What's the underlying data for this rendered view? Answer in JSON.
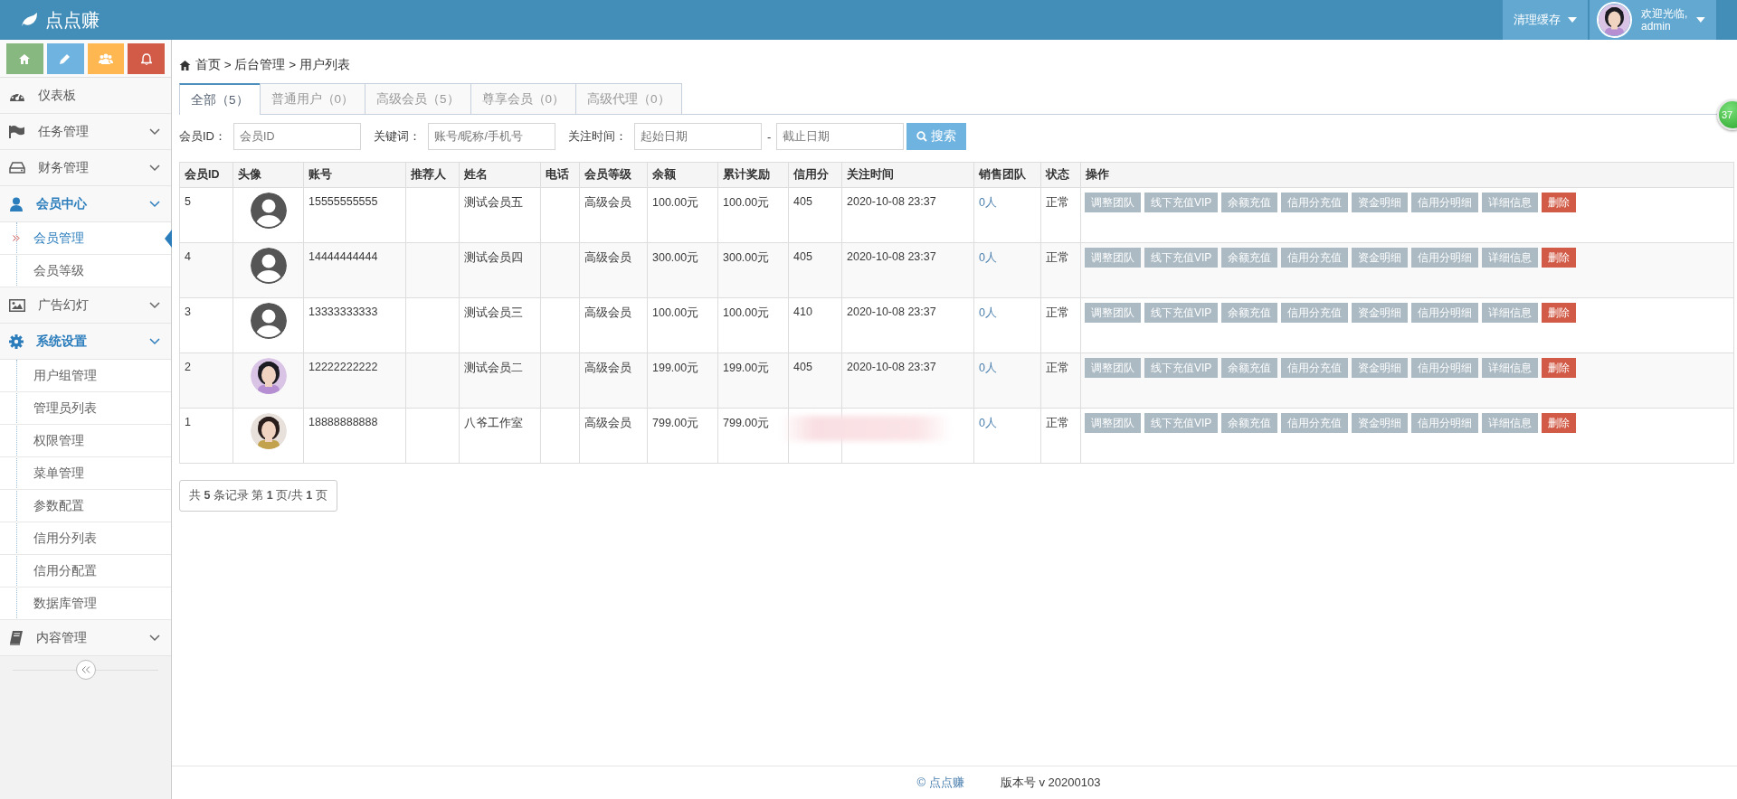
{
  "header": {
    "logo": "点点赚",
    "cache_button": "清理缓存",
    "welcome": "欢迎光临,",
    "user": "admin"
  },
  "badge": "37",
  "sidebar": {
    "shortcuts": [
      {
        "color": "#87b87f"
      },
      {
        "color": "#6fb3e0"
      },
      {
        "color": "#ffb752"
      },
      {
        "color": "#d15b47"
      }
    ],
    "items": [
      {
        "label": "仪表板",
        "kind": "link"
      },
      {
        "label": "任务管理",
        "kind": "menu",
        "expanded": false
      },
      {
        "label": "财务管理",
        "kind": "menu",
        "expanded": false
      },
      {
        "label": "会员中心",
        "kind": "menu",
        "expanded": true,
        "children": [
          {
            "label": "会员管理",
            "selected": true
          },
          {
            "label": "会员等级",
            "selected": false
          }
        ]
      },
      {
        "label": "广告幻灯",
        "kind": "menu",
        "expanded": false
      },
      {
        "label": "系统设置",
        "kind": "menu",
        "expanded": true,
        "children": [
          {
            "label": "用户组管理",
            "selected": false
          },
          {
            "label": "管理员列表",
            "selected": false
          },
          {
            "label": "权限管理",
            "selected": false
          },
          {
            "label": "菜单管理",
            "selected": false
          },
          {
            "label": "参数配置",
            "selected": false
          },
          {
            "label": "信用分列表",
            "selected": false
          },
          {
            "label": "信用分配置",
            "selected": false
          },
          {
            "label": "数据库管理",
            "selected": false
          }
        ]
      },
      {
        "label": "内容管理",
        "kind": "menu",
        "expanded": false
      }
    ]
  },
  "breadcrumb": "首页 > 后台管理 > 用户列表",
  "tabs": [
    {
      "label": "全部（5）",
      "selected": true
    },
    {
      "label": "普通用户（0）",
      "selected": false
    },
    {
      "label": "高级会员（5）",
      "selected": false
    },
    {
      "label": "尊享会员（0）",
      "selected": false
    },
    {
      "label": "高级代理（0）",
      "selected": false
    }
  ],
  "filters": {
    "member_id": {
      "label": "会员ID：",
      "placeholder": "会员ID"
    },
    "keyword": {
      "label": "关键词：",
      "placeholder": "账号/昵称/手机号"
    },
    "date": {
      "label": "关注时间：",
      "start_placeholder": "起始日期",
      "separator": "-",
      "end_placeholder": "截止日期"
    },
    "search_button": "搜索"
  },
  "table": {
    "columns": [
      "会员ID",
      "头像",
      "账号",
      "推荐人",
      "姓名",
      "电话",
      "会员等级",
      "余额",
      "累计奖励",
      "信用分",
      "关注时间",
      "销售团队",
      "状态",
      "操作"
    ],
    "rows": [
      {
        "id": "5",
        "avatar": {
          "kind": "default"
        },
        "account": "15555555555",
        "name": "测试会员五",
        "level": "高级会员",
        "balance": "100.00元",
        "reward": "100.00元",
        "credit": "405",
        "time": "2020-10-08 23:37",
        "team": "0人",
        "status": "正常",
        "actions": [
          {
            "label": "调整团队",
            "kind": "default"
          },
          {
            "label": "线下充值VIP",
            "kind": "default"
          },
          {
            "label": "余额充值",
            "kind": "default"
          },
          {
            "label": "信用分充值",
            "kind": "default"
          },
          {
            "label": "资金明细",
            "kind": "default"
          },
          {
            "label": "信用分明细",
            "kind": "default"
          },
          {
            "label": "详细信息",
            "kind": "default"
          },
          {
            "label": "删除",
            "kind": "danger"
          }
        ]
      },
      {
        "id": "4",
        "avatar": {
          "kind": "default"
        },
        "account": "14444444444",
        "name": "测试会员四",
        "level": "高级会员",
        "balance": "300.00元",
        "reward": "300.00元",
        "credit": "405",
        "time": "2020-10-08 23:37",
        "team": "0人",
        "status": "正常",
        "actions": [
          {
            "label": "调整团队",
            "kind": "default"
          },
          {
            "label": "线下充值VIP",
            "kind": "default"
          },
          {
            "label": "余额充值",
            "kind": "default"
          },
          {
            "label": "信用分充值",
            "kind": "default"
          },
          {
            "label": "资金明细",
            "kind": "default"
          },
          {
            "label": "信用分明细",
            "kind": "default"
          },
          {
            "label": "详细信息",
            "kind": "default"
          },
          {
            "label": "删除",
            "kind": "danger"
          }
        ]
      },
      {
        "id": "3",
        "avatar": {
          "kind": "default"
        },
        "account": "13333333333",
        "name": "测试会员三",
        "level": "高级会员",
        "balance": "100.00元",
        "reward": "100.00元",
        "credit": "410",
        "time": "2020-10-08 23:37",
        "team": "0人",
        "status": "正常",
        "actions": [
          {
            "label": "调整团队",
            "kind": "default"
          },
          {
            "label": "线下充值VIP",
            "kind": "default"
          },
          {
            "label": "余额充值",
            "kind": "default"
          },
          {
            "label": "信用分充值",
            "kind": "default"
          },
          {
            "label": "资金明细",
            "kind": "default"
          },
          {
            "label": "信用分明细",
            "kind": "default"
          },
          {
            "label": "详细信息",
            "kind": "default"
          },
          {
            "label": "删除",
            "kind": "danger"
          }
        ]
      },
      {
        "id": "2",
        "account": "12222222222",
        "name": "测试会员二",
        "level": "高级会员",
        "balance": "199.00元",
        "reward": "199.00元",
        "credit": "405",
        "time": "2020-10-08 23:37",
        "team": "0人",
        "status": "正常",
        "actions": [
          {
            "label": "调整团队",
            "kind": "default"
          },
          {
            "label": "线下充值VIP",
            "kind": "default"
          },
          {
            "label": "余额充值",
            "kind": "default"
          },
          {
            "label": "信用分充值",
            "kind": "default"
          },
          {
            "label": "资金明细",
            "kind": "default"
          },
          {
            "label": "信用分明细",
            "kind": "default"
          },
          {
            "label": "详细信息",
            "kind": "default"
          },
          {
            "label": "删除",
            "kind": "danger"
          }
        ]
      },
      {
        "id": "1",
        "account": "18888888888",
        "name": "八爷工作室",
        "level": "高级会员",
        "balance": "799.00元",
        "reward": "799.00元",
        "redacted": true,
        "team": "0人",
        "status": "正常",
        "actions": [
          {
            "label": "调整团队",
            "kind": "default"
          },
          {
            "label": "线下充值VIP",
            "kind": "default"
          },
          {
            "label": "余额充值",
            "kind": "default"
          },
          {
            "label": "信用分充值",
            "kind": "default"
          },
          {
            "label": "资金明细",
            "kind": "default"
          },
          {
            "label": "信用分明细",
            "kind": "default"
          },
          {
            "label": "详细信息",
            "kind": "default"
          },
          {
            "label": "删除",
            "kind": "danger"
          }
        ]
      }
    ]
  },
  "pagination": "共 **5** 条记录 第 **1** 页/共 **1** 页",
  "footer": {
    "copyright": "© 点点赚",
    "version": "版本号 v 20200103"
  }
}
